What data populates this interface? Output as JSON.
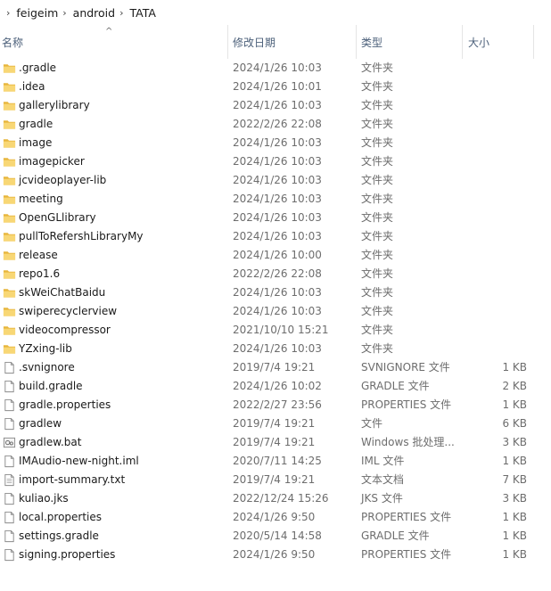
{
  "breadcrumb": [
    "feigeim",
    "android",
    "TATA"
  ],
  "columns": {
    "name": "名称",
    "date": "修改日期",
    "type": "类型",
    "size": "大小"
  },
  "files": [
    {
      "name": ".gradle",
      "date": "2024/1/26 10:03",
      "type": "文件夹",
      "size": "",
      "icon": "folder-icon"
    },
    {
      "name": ".idea",
      "date": "2024/1/26 10:01",
      "type": "文件夹",
      "size": "",
      "icon": "folder-icon"
    },
    {
      "name": "gallerylibrary",
      "date": "2024/1/26 10:03",
      "type": "文件夹",
      "size": "",
      "icon": "folder-icon"
    },
    {
      "name": "gradle",
      "date": "2022/2/26 22:08",
      "type": "文件夹",
      "size": "",
      "icon": "folder-icon"
    },
    {
      "name": "image",
      "date": "2024/1/26 10:03",
      "type": "文件夹",
      "size": "",
      "icon": "folder-icon"
    },
    {
      "name": "imagepicker",
      "date": "2024/1/26 10:03",
      "type": "文件夹",
      "size": "",
      "icon": "folder-icon"
    },
    {
      "name": "jcvideoplayer-lib",
      "date": "2024/1/26 10:03",
      "type": "文件夹",
      "size": "",
      "icon": "folder-icon"
    },
    {
      "name": "meeting",
      "date": "2024/1/26 10:03",
      "type": "文件夹",
      "size": "",
      "icon": "folder-icon"
    },
    {
      "name": "OpenGLlibrary",
      "date": "2024/1/26 10:03",
      "type": "文件夹",
      "size": "",
      "icon": "folder-icon"
    },
    {
      "name": "pullToRefershLibraryMy",
      "date": "2024/1/26 10:03",
      "type": "文件夹",
      "size": "",
      "icon": "folder-icon"
    },
    {
      "name": "release",
      "date": "2024/1/26 10:00",
      "type": "文件夹",
      "size": "",
      "icon": "folder-icon"
    },
    {
      "name": "repo1.6",
      "date": "2022/2/26 22:08",
      "type": "文件夹",
      "size": "",
      "icon": "folder-icon"
    },
    {
      "name": "skWeiChatBaidu",
      "date": "2024/1/26 10:03",
      "type": "文件夹",
      "size": "",
      "icon": "folder-icon"
    },
    {
      "name": "swiperecyclerview",
      "date": "2024/1/26 10:03",
      "type": "文件夹",
      "size": "",
      "icon": "folder-icon"
    },
    {
      "name": "videocompressor",
      "date": "2021/10/10 15:21",
      "type": "文件夹",
      "size": "",
      "icon": "folder-icon"
    },
    {
      "name": "YZxing-lib",
      "date": "2024/1/26 10:03",
      "type": "文件夹",
      "size": "",
      "icon": "folder-icon"
    },
    {
      "name": ".svnignore",
      "date": "2019/7/4 19:21",
      "type": "SVNIGNORE 文件",
      "size": "1 KB",
      "icon": "file-icon"
    },
    {
      "name": "build.gradle",
      "date": "2024/1/26 10:02",
      "type": "GRADLE 文件",
      "size": "2 KB",
      "icon": "file-icon"
    },
    {
      "name": "gradle.properties",
      "date": "2022/2/27 23:56",
      "type": "PROPERTIES 文件",
      "size": "1 KB",
      "icon": "file-icon"
    },
    {
      "name": "gradlew",
      "date": "2019/7/4 19:21",
      "type": "文件",
      "size": "6 KB",
      "icon": "file-icon"
    },
    {
      "name": "gradlew.bat",
      "date": "2019/7/4 19:21",
      "type": "Windows 批处理...",
      "size": "3 KB",
      "icon": "batch-file-icon"
    },
    {
      "name": "IMAudio-new-night.iml",
      "date": "2020/7/11 14:25",
      "type": "IML 文件",
      "size": "1 KB",
      "icon": "file-icon"
    },
    {
      "name": "import-summary.txt",
      "date": "2019/7/4 19:21",
      "type": "文本文档",
      "size": "7 KB",
      "icon": "text-file-icon"
    },
    {
      "name": "kuliao.jks",
      "date": "2022/12/24 15:26",
      "type": "JKS 文件",
      "size": "3 KB",
      "icon": "file-icon"
    },
    {
      "name": "local.properties",
      "date": "2024/1/26 9:50",
      "type": "PROPERTIES 文件",
      "size": "1 KB",
      "icon": "file-icon"
    },
    {
      "name": "settings.gradle",
      "date": "2020/5/14 14:58",
      "type": "GRADLE 文件",
      "size": "1 KB",
      "icon": "file-icon"
    },
    {
      "name": "signing.properties",
      "date": "2024/1/26 9:50",
      "type": "PROPERTIES 文件",
      "size": "1 KB",
      "icon": "file-icon"
    }
  ],
  "colors": {
    "folder": "#f8d775",
    "folder_dark": "#e7b53c",
    "header_text": "#4c607a",
    "meta_text": "#6d6d6d"
  }
}
